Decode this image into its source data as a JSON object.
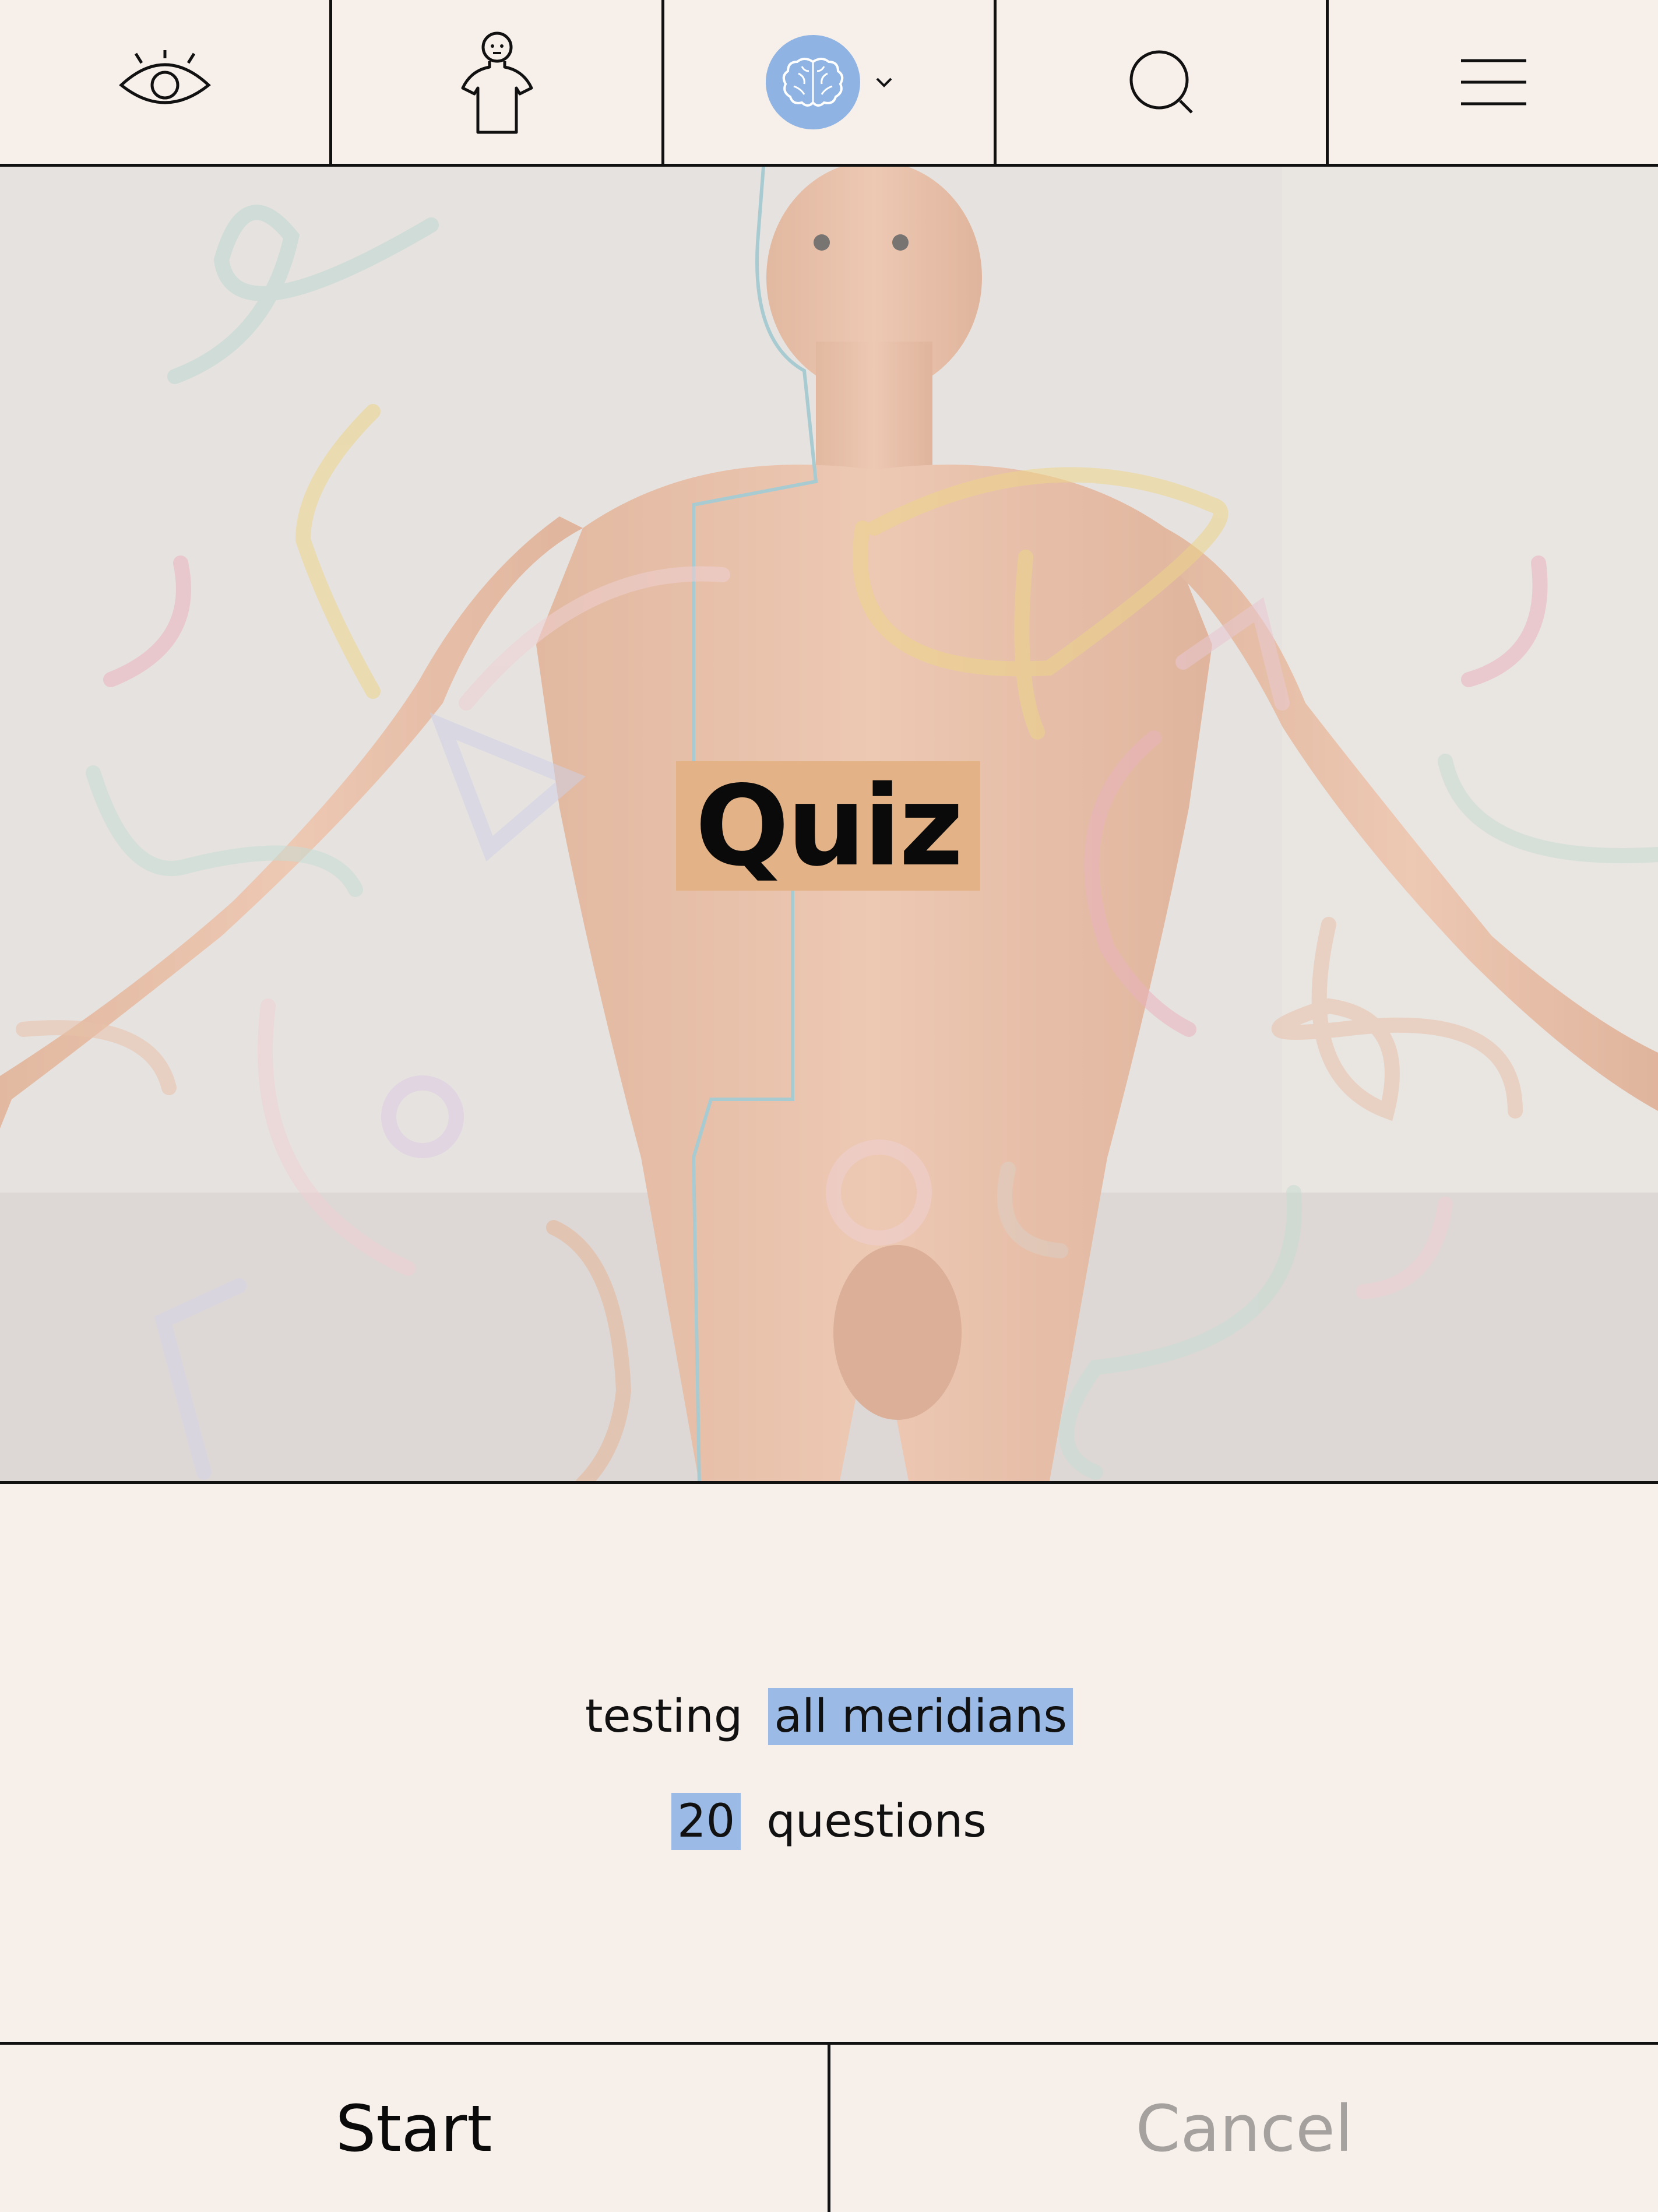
{
  "toolbar": {
    "items": [
      {
        "icon": "eye-icon"
      },
      {
        "icon": "body-figure-icon"
      },
      {
        "icon": "brain-icon",
        "dropdown": "chevron-down-icon",
        "accent": "#8fb4e4"
      },
      {
        "icon": "search-icon"
      },
      {
        "icon": "hamburger-menu-icon"
      }
    ]
  },
  "viewer": {
    "badge": "Quiz",
    "badge_color": "#e3b387"
  },
  "info": {
    "testing_label": "testing",
    "testing_value": "all meridians",
    "question_count": "20",
    "questions_label": "questions",
    "highlight_color": "#9bbbe6"
  },
  "actions": {
    "start": "Start",
    "cancel": "Cancel"
  }
}
